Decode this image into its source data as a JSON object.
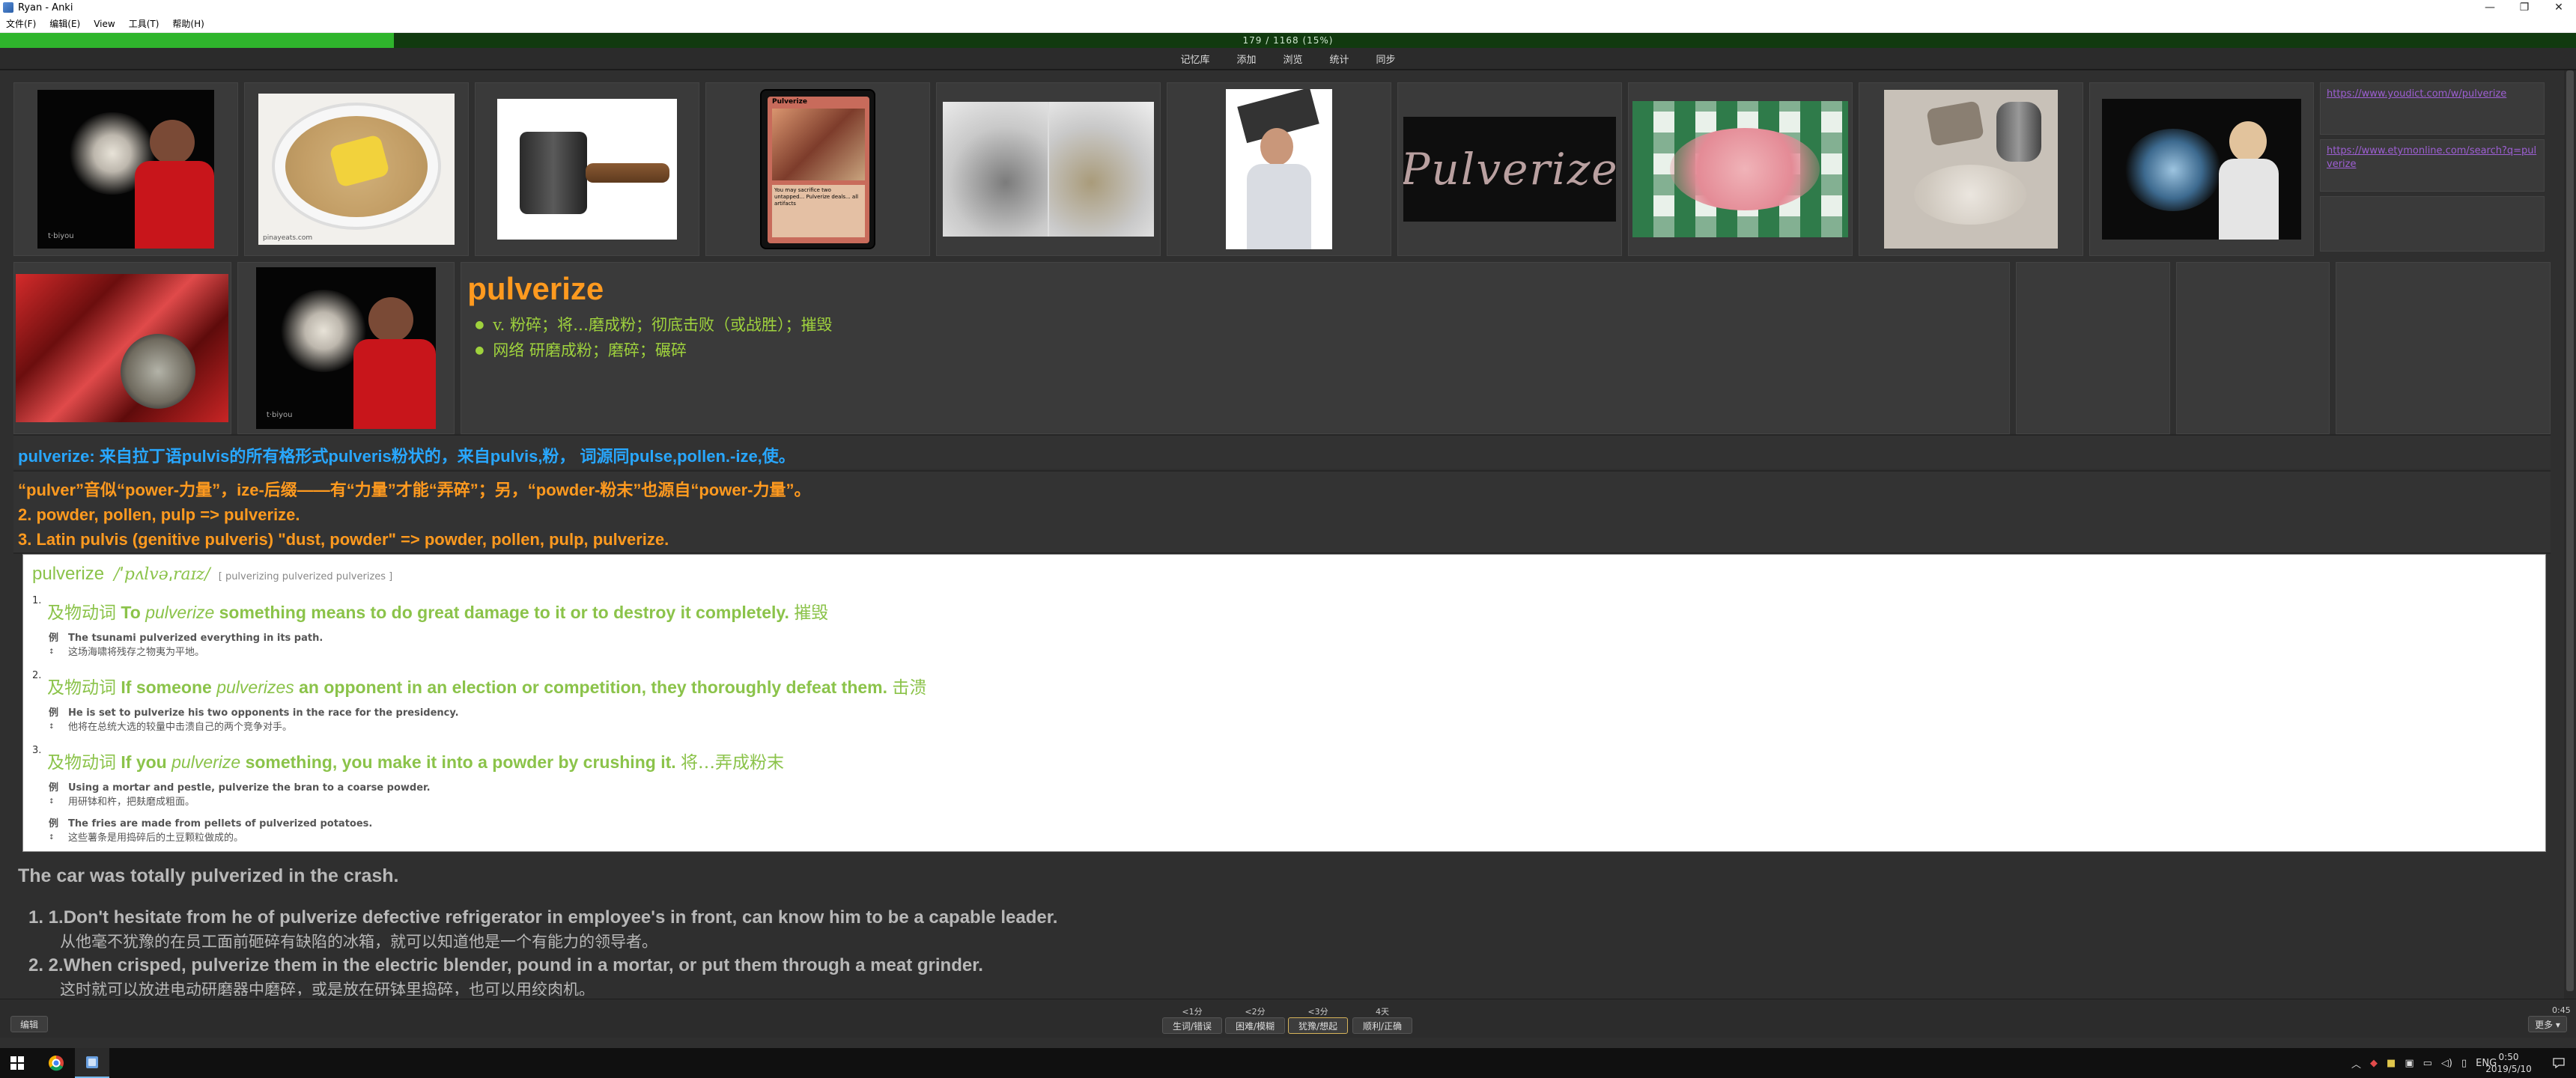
{
  "window": {
    "title": "Ryan - Anki",
    "minimize": "—",
    "maximize": "❐",
    "close": "✕"
  },
  "menu": [
    "文件(F)",
    "编辑(E)",
    "View",
    "工具(T)",
    "帮助(H)"
  ],
  "progress": {
    "text": "179 / 1168 (15%)",
    "fraction": 0.153
  },
  "toolbar": [
    "记忆库",
    "添加",
    "浏览",
    "统计",
    "同步"
  ],
  "links": [
    "https://www.youdict.com/w/pulverize",
    "https://www.etymonline.com/search?q=pulverize"
  ],
  "images": {
    "shirt_caption": "t·biyou",
    "food_caption": "pinayeats.com",
    "card_caption": "Pulverize",
    "card_text": "You may sacrifice two untapped... Pulverize deals... all artifacts",
    "pulverize_logo": "Pulverize"
  },
  "card": {
    "word": "pulverize",
    "defs": [
      "v. 粉碎；将…磨成粉；彻底击败（或战胜）；摧毁",
      "网络 研磨成粉；磨碎；碾碎"
    ],
    "etymology": "pulverize: 来自拉丁语pulvis的所有格形式pulveris粉状的，来自pulvis,粉， 词源同pulse,pollen.-ize,使。",
    "memo": [
      "“pulver”音似“power-力量”，ize-后缀——有“力量”才能“弄碎”；另，“powder-粉末”也源自“power-力量”。",
      "2. powder, pollen, pulp => pulverize.",
      "3. Latin pulvis (genitive pulveris) \"dust, powder\" => powder, pollen, pulp, pulverize."
    ]
  },
  "dict": {
    "headword": "pulverize",
    "pron": "/ˈpʌlvəˌraɪz/",
    "forms": "[ pulverizing pulverized pulverizes ]",
    "senses": [
      {
        "num": "1.",
        "pos": "及物动词",
        "pre": "To",
        "kw": "pulverize",
        "post": "something means to do great damage to it or to destroy it completely.",
        "zh": "摧毁",
        "examples": [
          {
            "en": "The tsunami pulverized everything in its path.",
            "zh": "这场海啸将残存之物夷为平地。"
          }
        ]
      },
      {
        "num": "2.",
        "pos": "及物动词",
        "pre": "If someone",
        "kw": "pulverizes",
        "post": "an opponent in an election or competition, they thoroughly defeat them.",
        "zh": "击溃",
        "examples": [
          {
            "en": "He is set to pulverize his two opponents in the race for the presidency.",
            "zh": "他将在总统大选的较量中击溃自己的两个竞争对手。"
          }
        ]
      },
      {
        "num": "3.",
        "pos": "及物动词",
        "pre": "If you",
        "kw": "pulverize",
        "post": "something, you make it into a powder by crushing it.",
        "zh": "将…弄成粉末",
        "examples": [
          {
            "en": "Using a mortar and pestle, pulverize the bran to a coarse powder.",
            "zh": "用研钵和杵，把麸磨成粗面。"
          },
          {
            "en": "The fries are made from pellets of pulverized potatoes.",
            "zh": "这些薯条是用捣碎后的土豆颗粒做成的。"
          }
        ]
      }
    ],
    "ex_label": "例",
    "bullet": "↕"
  },
  "sentence": "The car was totally pulverized in the crash.",
  "examples": [
    {
      "en": "1. 1.Don't hesitate from he of pulverize defective refrigerator in employee's in front, can know him to be a capable leader.",
      "zh": "从他毫不犹豫的在员工面前砸碎有缺陷的冰箱，就可以知道他是一个有能力的领导者。"
    },
    {
      "en": "2. 2.When crisped, pulverize them in the electric blender, pound in a mortar, or put them through a meat grinder.",
      "zh": "这时就可以放进电动研磨器中磨碎，或是放在研钵里捣碎，也可以用绞肉机。"
    }
  ],
  "answer": {
    "edit": "编辑",
    "more": "更多 ▾",
    "timer": "0:45",
    "buttons": [
      {
        "time": "<1分",
        "label": "生词/错误"
      },
      {
        "time": "<2分",
        "label": "困难/模糊"
      },
      {
        "time": "<3分",
        "label": "犹豫/想起"
      },
      {
        "time": "4天",
        "label": "顺利/正确"
      }
    ]
  },
  "taskbar": {
    "lang": "ENG",
    "time": "0:50",
    "date": "2019/5/10"
  },
  "colors": {
    "accent_orange": "#ff9a1f",
    "green": "#9fd23d",
    "blue": "#28a7ff",
    "progress": "#2fb52c"
  }
}
